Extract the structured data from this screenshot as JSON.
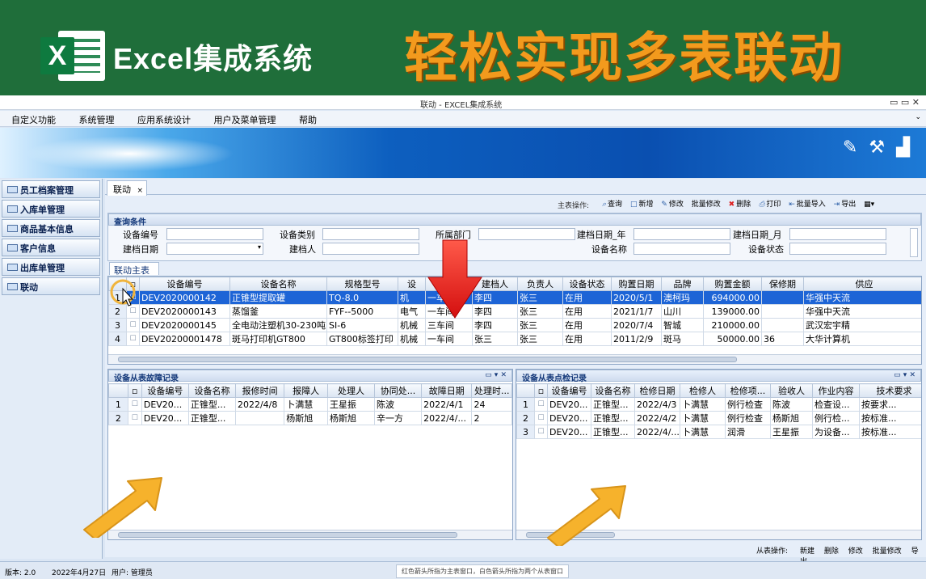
{
  "banner": {
    "logo_letter": "X",
    "title": "Excel集成系统",
    "slogan": "轻松实现多表联动",
    "bg_color": "#1f6e3a",
    "slogan_color": "#f39a1d"
  },
  "window": {
    "title": "联动 - EXCEL集成系统",
    "controls": "▭  ▭  ✕"
  },
  "menu": {
    "items": [
      "自定义功能",
      "系统管理",
      "应用系统设计",
      "用户及菜单管理",
      "帮助"
    ]
  },
  "sidebar": {
    "items": [
      {
        "label": "员工档案管理"
      },
      {
        "label": "入库单管理"
      },
      {
        "label": "商品基本信息"
      },
      {
        "label": "客户信息"
      },
      {
        "label": "出库单管理"
      },
      {
        "label": "联动"
      }
    ]
  },
  "tab": {
    "label": "联动",
    "close": "×"
  },
  "toolbar": {
    "label": "主表操作:",
    "buttons": [
      {
        "icon": "search-icon",
        "label": "查询"
      },
      {
        "icon": "new-icon",
        "label": "新增"
      },
      {
        "icon": "edit-icon",
        "label": "修改"
      },
      {
        "icon": "batch-edit-icon",
        "label": "批量修改"
      },
      {
        "icon": "delete-icon",
        "label": "删除"
      },
      {
        "icon": "print-icon",
        "label": "打印"
      },
      {
        "icon": "import-icon",
        "label": "批量导入"
      },
      {
        "icon": "export-icon",
        "label": "导出"
      }
    ]
  },
  "query": {
    "title": "查询条件",
    "fields": {
      "device_no": "设备编号",
      "device_type": "设备类别",
      "dept": "所属部门",
      "create_year": "建档日期_年",
      "create_month": "建档日期_月",
      "create_date": "建档日期",
      "creator": "建档人",
      "device_name": "设备名称",
      "device_status": "设备状态"
    }
  },
  "main_table": {
    "tab_label": "联动主表",
    "columns": [
      "设备编号",
      "设备名称",
      "规格型号",
      "设",
      "部门",
      "建档人",
      "负责人",
      "设备状态",
      "购置日期",
      "品牌",
      "购置金额",
      "保修期",
      "供应"
    ],
    "rows": [
      {
        "rowno": "1",
        "cells": [
          "DEV2020000142",
          "正锥型提取罐",
          "TQ-8.0",
          "机",
          "一车间",
          "李四",
          "张三",
          "在用",
          "2020/5/1",
          "澳柯玛",
          "694000.00",
          "",
          "华强中天流"
        ]
      },
      {
        "rowno": "2",
        "cells": [
          "DEV2020000143",
          "蒸馏釜",
          "FYF--5000",
          "电气",
          "一车间",
          "李四",
          "张三",
          "在用",
          "2021/1/7",
          "山川",
          "139000.00",
          "",
          "华强中天流"
        ]
      },
      {
        "rowno": "3",
        "cells": [
          "DEV2020000145",
          "全电动注塑机30-230吨",
          "SI-6",
          "机械",
          "三车间",
          "李四",
          "张三",
          "在用",
          "2020/7/4",
          "智城",
          "210000.00",
          "",
          "武汉宏宇精"
        ]
      },
      {
        "rowno": "4",
        "cells": [
          "DEV20200001478",
          "斑马打印机GT800",
          "GT800标签打印",
          "机械",
          "一车间",
          "张三",
          "张三",
          "在用",
          "2011/2/9",
          "斑马",
          "50000.00",
          "36",
          "大华计算机"
        ]
      }
    ]
  },
  "fault_table": {
    "title": "设备从表故障记录",
    "columns": [
      "设备编号",
      "设备名称",
      "报修时间",
      "报障人",
      "处理人",
      "协同处...",
      "故障日期",
      "处理时..."
    ],
    "rows": [
      {
        "rowno": "1",
        "cells": [
          "DEV20...",
          "正锥型...",
          "2022/4/8",
          "卜满慧",
          "王星振",
          "陈波",
          "2022/4/1",
          "24"
        ]
      },
      {
        "rowno": "2",
        "cells": [
          "DEV20...",
          "正锥型...",
          "",
          "杨斯旭",
          "杨斯旭",
          "辛一方",
          "2022/4/...",
          "2"
        ]
      }
    ]
  },
  "inspect_table": {
    "title": "设备从表点检记录",
    "columns": [
      "设备编号",
      "设备名称",
      "检修日期",
      "检修人",
      "检修项...",
      "验收人",
      "作业内容",
      "技术要求"
    ],
    "rows": [
      {
        "rowno": "1",
        "cells": [
          "DEV20...",
          "正锥型...",
          "2022/4/3",
          "卜满慧",
          "例行检查",
          "陈波",
          "检查设...",
          "按要求..."
        ]
      },
      {
        "rowno": "2",
        "cells": [
          "DEV20...",
          "正锥型...",
          "2022/4/2",
          "卜满慧",
          "例行检查",
          "杨斯旭",
          "例行检...",
          "按标准..."
        ]
      },
      {
        "rowno": "3",
        "cells": [
          "DEV20...",
          "正锥型...",
          "2022/4/...",
          "卜满慧",
          "润滑",
          "王星振",
          "为设备...",
          "按标准..."
        ]
      }
    ]
  },
  "sub_toolbar": {
    "label": "从表操作:",
    "buttons": [
      "新建",
      "删除",
      "修改",
      "批量修改",
      "导出"
    ]
  },
  "status": {
    "version": "版本: 2.0",
    "date": "2022年4月27日",
    "user": "用户: 管理员",
    "hint": "红色箭头所指为主表窗口，白色箭头所指为两个从表窗口"
  }
}
